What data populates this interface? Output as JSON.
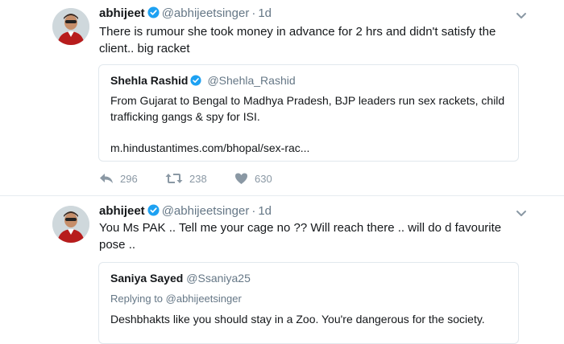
{
  "tweets": [
    {
      "name": "abhijeet",
      "handle": "@abhijeetsinger",
      "dot": "·",
      "time": "1d",
      "text": "There is rumour she took money in advance for 2 hrs and didn't satisfy the client.. big racket",
      "quote": {
        "name": "Shehla Rashid",
        "handle": "@Shehla_Rashid",
        "text": "From Gujarat to Bengal to Madhya Pradesh, BJP leaders run sex rackets, child trafficking gangs & spy for ISI.",
        "link": "m.hindustantimes.com/bhopal/sex-rac..."
      },
      "actions": {
        "replies": "296",
        "retweets": "238",
        "likes": "630"
      }
    },
    {
      "name": "abhijeet",
      "handle": "@abhijeetsinger",
      "dot": "·",
      "time": "1d",
      "text": "You Ms PAK .. Tell me your cage no ?? Will reach there .. will do d  favourite pose ..",
      "quote": {
        "name": "Saniya Sayed",
        "handle": "@Ssaniya25",
        "replying_to": "Replying to @abhijeetsinger",
        "text": "Deshbhakts like you should stay in a Zoo. You're dangerous for the society."
      }
    }
  ],
  "icons": {
    "verified": "verified-badge-icon",
    "chevron": "chevron-down-icon",
    "reply": "reply-icon",
    "retweet": "retweet-icon",
    "like": "heart-icon"
  },
  "colors": {
    "verified": "#1da1f2",
    "secondary_text": "#657786",
    "action_icon": "#8a98a4",
    "border": "#e1e8ed"
  }
}
